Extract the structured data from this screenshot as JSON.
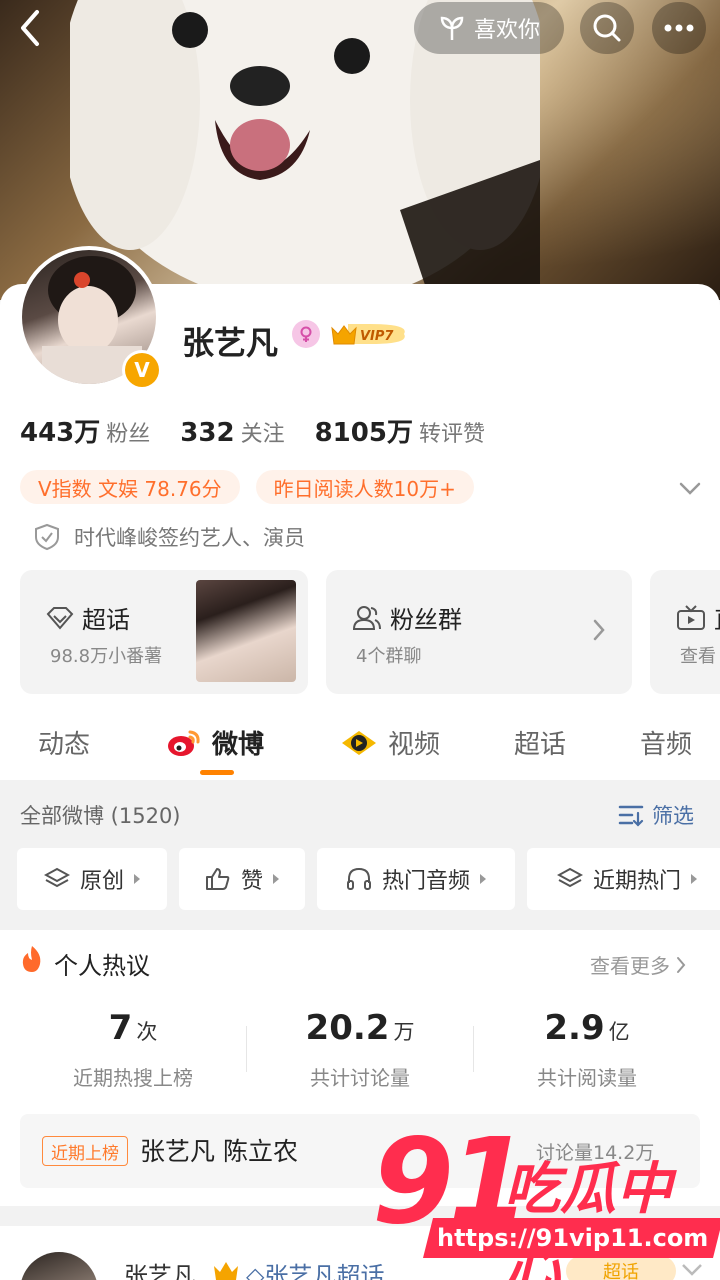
{
  "header": {
    "like_label": "喜欢你"
  },
  "profile": {
    "name": "张艺凡",
    "vip_label": "VIP7",
    "verified_badge": "V",
    "stats": [
      {
        "value": "443万",
        "label": "粉丝"
      },
      {
        "value": "332",
        "label": "关注"
      },
      {
        "value": "8105万",
        "label": "转评赞"
      }
    ],
    "tags": [
      "V指数 文娱 78.76分",
      "昨日阅读人数10万+"
    ],
    "verification": "时代峰峻签约艺人、演员"
  },
  "tiles": [
    {
      "title": "超话",
      "subtitle": "98.8万小番薯"
    },
    {
      "title": "粉丝群",
      "subtitle": "4个群聊"
    },
    {
      "title": "直",
      "subtitle": "查看"
    }
  ],
  "tabs": [
    {
      "label": "动态"
    },
    {
      "label": "微博"
    },
    {
      "label": "视频"
    },
    {
      "label": "超话"
    },
    {
      "label": "音频"
    }
  ],
  "feed": {
    "all_label": "全部微博 (1520)",
    "filter_label": "筛选",
    "chips": [
      "原创",
      "赞",
      "热门音频",
      "近期热门"
    ]
  },
  "hot": {
    "title": "个人热议",
    "more_label": "查看更多",
    "metrics": [
      {
        "value": "7",
        "unit": "次",
        "desc": "近期热搜上榜"
      },
      {
        "value": "20.2",
        "unit": "万",
        "desc": "共计讨论量"
      },
      {
        "value": "2.9",
        "unit": "亿",
        "desc": "共计阅读量"
      }
    ],
    "trend": {
      "label": "近期上榜",
      "text": "张艺凡 陈立农",
      "count": "讨论量14.2万"
    }
  },
  "post": {
    "name": "张艺凡",
    "topic": "张艺凡超话",
    "pill": "超话"
  },
  "watermark": {
    "number": "91",
    "text": "吃瓜中心",
    "url": "https://91vip11.com"
  },
  "colors": {
    "accent": "#ff8200",
    "tag_text": "#ff6f2c",
    "link": "#4a6fa5",
    "watermark": "#ff2d4e"
  }
}
